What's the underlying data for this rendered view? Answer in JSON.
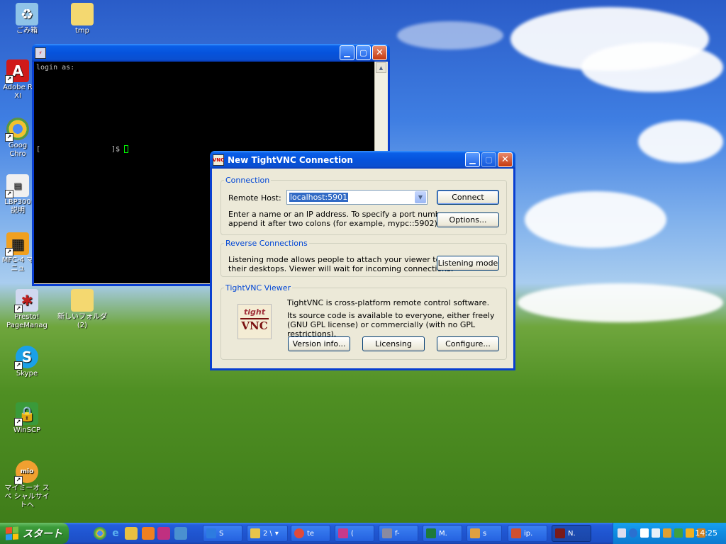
{
  "desktop_icons": [
    {
      "label": "ごみ箱",
      "icon": "recycle-bin-icon"
    },
    {
      "label": "tmp",
      "icon": "folder-icon"
    },
    {
      "label": "Adobe R XI",
      "icon": "adobe-reader-icon"
    },
    {
      "label": "Goog Chro",
      "icon": "chrome-icon"
    },
    {
      "label": "LBP300 説明",
      "icon": "printer-manual-icon"
    },
    {
      "label": "MFC-4 マニュ",
      "icon": "mfc-manual-icon"
    },
    {
      "label": "Presto! PageManag",
      "icon": "presto-icon"
    },
    {
      "label": "新しいフォルダ (2)",
      "icon": "folder-icon"
    },
    {
      "label": "Skype",
      "icon": "skype-icon"
    },
    {
      "label": "WinSCP",
      "icon": "winscp-icon"
    },
    {
      "label": "マイミーオ スペ シャルサイトへ",
      "icon": "mymio-icon"
    }
  ],
  "terminal": {
    "title": "",
    "line1": "login as:",
    "prompt_open": "[",
    "prompt_close": "]$"
  },
  "vnc_dialog": {
    "title": "New TightVNC Connection",
    "connection": {
      "legend": "Connection",
      "remote_host_label": "Remote Host:",
      "remote_host_value": "localhost:5901",
      "help_line1": "Enter a name or an IP address. To specify a port number,",
      "help_line2": "append it after two colons (for example, mypc::5902).",
      "connect_label": "Connect",
      "options_label": "Options..."
    },
    "reverse": {
      "legend": "Reverse Connections",
      "text_line1": "Listening mode allows people to attach your viewer to",
      "text_line2": "their desktops. Viewer will wait for incoming connections.",
      "listening_label": "Listening mode"
    },
    "viewer": {
      "legend": "TightVNC Viewer",
      "line1": "TightVNC is cross-platform remote control software.",
      "line2": "Its source code is available to everyone, either freely",
      "line3": "(GNU GPL license) or commercially (with no GPL restrictions).",
      "logo_top": "tight",
      "logo_bottom": "VNC",
      "version_label": "Version info...",
      "licensing_label": "Licensing",
      "configure_label": "Configure..."
    }
  },
  "taskbar": {
    "start_label": "スタート",
    "items": [
      {
        "label": "S",
        "color": "#2d7be0"
      },
      {
        "label": "2 \\",
        "color": "#e8c44a"
      },
      {
        "label": "te",
        "color": "#e04a3a"
      },
      {
        "label": "(",
        "color": "#c83a8a"
      },
      {
        "label": "f-",
        "color": "#8a8aa0"
      },
      {
        "label": "M.",
        "color": "#1e7a3a"
      },
      {
        "label": "s",
        "color": "#e0a040"
      },
      {
        "label": "ip.",
        "color": "#d05030"
      },
      {
        "label": "N.",
        "color": "#7a1a1a"
      }
    ],
    "clock": "14:25"
  },
  "colors": {
    "title_blue": "#0653dc",
    "group_legend": "#0046d5",
    "dialog_bg": "#ece9d8"
  }
}
